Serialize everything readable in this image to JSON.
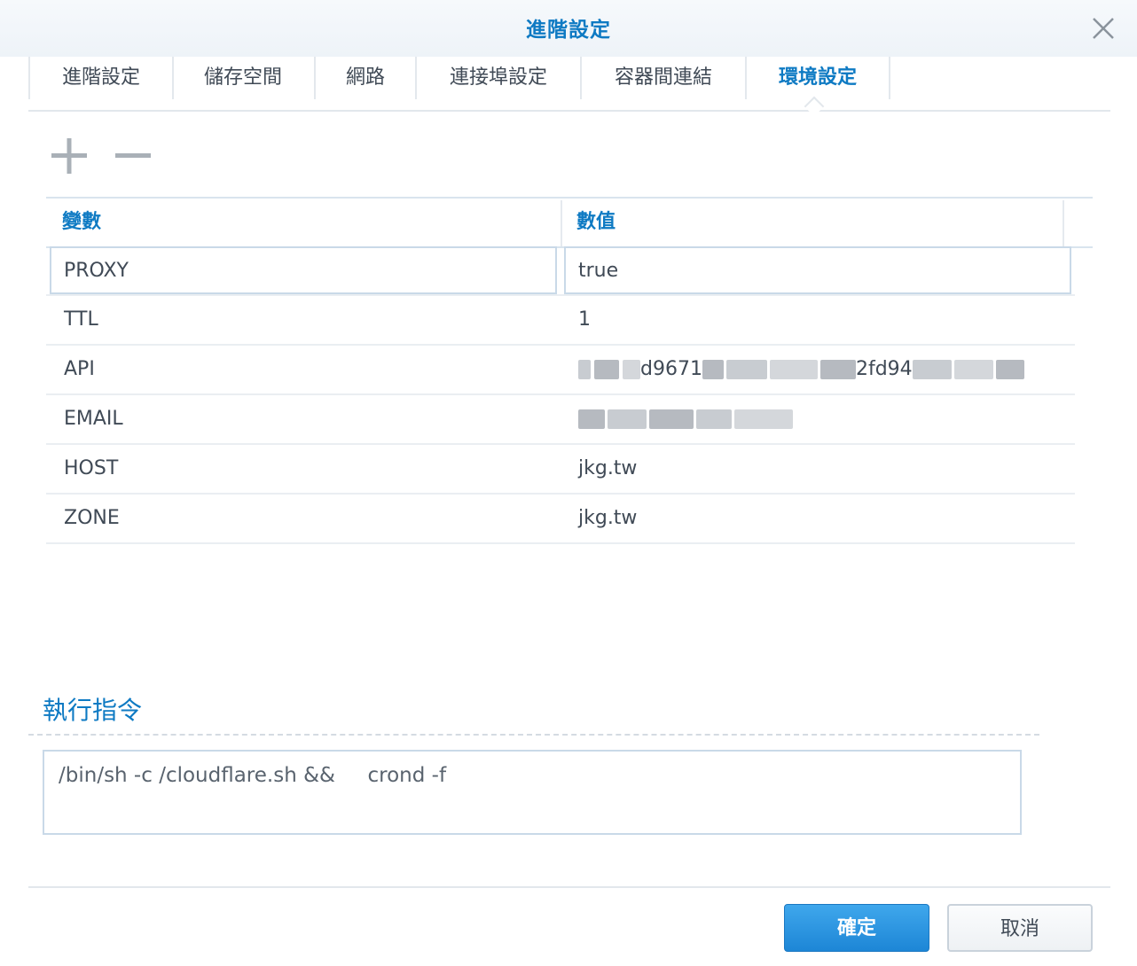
{
  "dialog": {
    "title": "進階設定",
    "close_icon": "close-icon"
  },
  "tabs": [
    {
      "label": "進階設定",
      "active": false
    },
    {
      "label": "儲存空間",
      "active": false
    },
    {
      "label": "網路",
      "active": false
    },
    {
      "label": "連接埠設定",
      "active": false
    },
    {
      "label": "容器間連結",
      "active": false
    },
    {
      "label": "環境設定",
      "active": true
    }
  ],
  "toolbar": {
    "add_icon": "plus-icon",
    "remove_icon": "minus-icon"
  },
  "env_table": {
    "columns": [
      "變數",
      "數值"
    ],
    "rows": [
      {
        "variable": "PROXY",
        "value": "true",
        "editing": true
      },
      {
        "variable": "TTL",
        "value": "1"
      },
      {
        "variable": "API",
        "value_visible_fragments": [
          "d9671",
          "2fd94"
        ],
        "value_obscured": true
      },
      {
        "variable": "EMAIL",
        "value_obscured": true
      },
      {
        "variable": "HOST",
        "value": "jkg.tw"
      },
      {
        "variable": "ZONE",
        "value": "jkg.tw"
      }
    ]
  },
  "command": {
    "section_title": "執行指令",
    "value": "/bin/sh -c /cloudflare.sh &&     crond -f"
  },
  "footer": {
    "ok_label": "確定",
    "cancel_label": "取消"
  },
  "colors": {
    "accent": "#0e7ac3",
    "primary_button": "#2a93e0",
    "text": "#404a56",
    "border": "#c9d9e8"
  }
}
